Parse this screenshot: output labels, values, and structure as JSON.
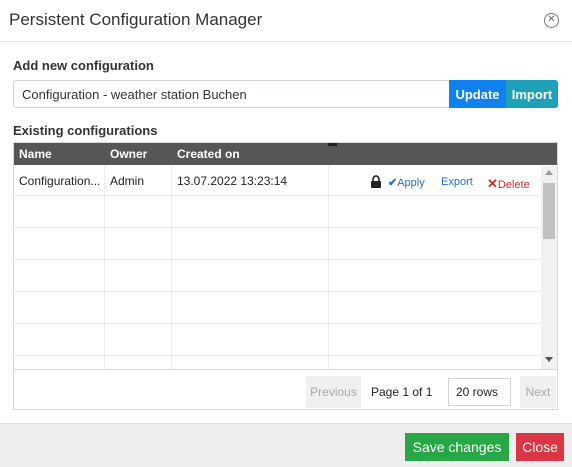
{
  "dialog": {
    "title": "Persistent Configuration Manager",
    "close_icon": "circle-x-icon"
  },
  "add_section": {
    "label": "Add new configuration",
    "input_value": "Configuration - weather station Buchen",
    "update_label": "Update",
    "import_label": "Import"
  },
  "existing_section": {
    "label": "Existing configurations"
  },
  "grid": {
    "columns": [
      "Name",
      "Owner",
      "Created on"
    ],
    "rows": [
      {
        "name": "Configuration...",
        "owner": "Admin",
        "created_on": "13.07.2022 13:23:14",
        "apply_label": "Apply",
        "export_label": "Export",
        "delete_label": "Delete"
      }
    ]
  },
  "pager": {
    "prev_label": "Previous",
    "page_text": "Page 1 of 1",
    "rows_value": "20 rows",
    "next_label": "Next"
  },
  "footer": {
    "save_label": "Save changes",
    "close_label": "Close"
  },
  "colors": {
    "update": "#0f82f0",
    "import": "#1ea0b8",
    "save": "#27a746",
    "close": "#dc3545",
    "grid_header": "#565656"
  }
}
